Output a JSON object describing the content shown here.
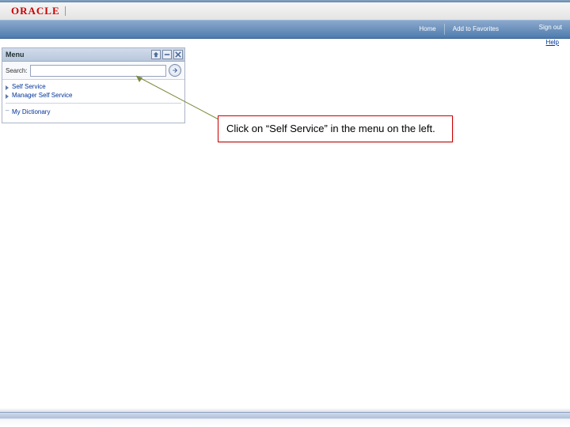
{
  "header": {
    "logo_text": "ORACLE",
    "nav": [
      "Home",
      "Add to Favorites"
    ],
    "signout": "Sign out",
    "help": "Help"
  },
  "menu": {
    "title": "Menu",
    "search_label": "Search:",
    "search_value": "",
    "items": [
      "Self Service",
      "Manager Self Service"
    ],
    "footer_item": "My Dictionary"
  },
  "callout": {
    "text": "Click on  “Self Service” in the menu on the left."
  }
}
